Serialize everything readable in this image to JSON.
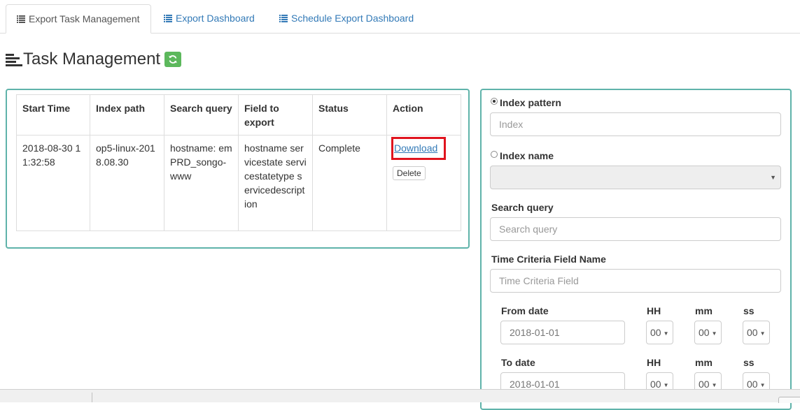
{
  "tabs": [
    {
      "label": "Export Task Management",
      "icon": "list-icon",
      "active": true
    },
    {
      "label": "Export Dashboard",
      "icon": "list-icon",
      "active": false
    },
    {
      "label": "Schedule Export Dashboard",
      "icon": "list-icon",
      "active": false
    }
  ],
  "page": {
    "title": "Task Management",
    "title_icon": "align-left-icon",
    "refresh_icon": "refresh-icon"
  },
  "table": {
    "headers": [
      "Start Time",
      "Index path",
      "Search query",
      "Field to export",
      "Status",
      "Action"
    ],
    "rows": [
      {
        "start_time": "2018-08-30 11:32:58",
        "index_path": "op5-linux-2018.08.30",
        "search_query": "hostname: emPRD_songo-www",
        "fields": "hostname servicestate servicestatetype servicedescription",
        "status": "Complete",
        "download_label": "Download",
        "delete_label": "Delete"
      }
    ]
  },
  "form": {
    "index_pattern_label": "Index pattern",
    "index_pattern_placeholder": "Index",
    "index_name_label": "Index name",
    "index_name_value": "",
    "search_query_label": "Search query",
    "search_query_placeholder": "Search query",
    "time_field_label": "Time Criteria Field Name",
    "time_field_placeholder": "Time Criteria Field",
    "from_date_label": "From date",
    "to_date_label": "To date",
    "hh_label": "HH",
    "mm_label": "mm",
    "ss_label": "ss",
    "from_date_value": "2018-01-01",
    "to_date_value": "2018-01-01",
    "from_hh": "00",
    "from_mm": "00",
    "from_ss": "00",
    "to_hh": "00",
    "to_mm": "00",
    "to_ss": "00",
    "selected_radio": "index_pattern"
  },
  "colors": {
    "accent": "#337ab7",
    "panel_border": "#5fb3aa",
    "refresh_button": "#5cb85c",
    "highlight": "#e0141e"
  }
}
